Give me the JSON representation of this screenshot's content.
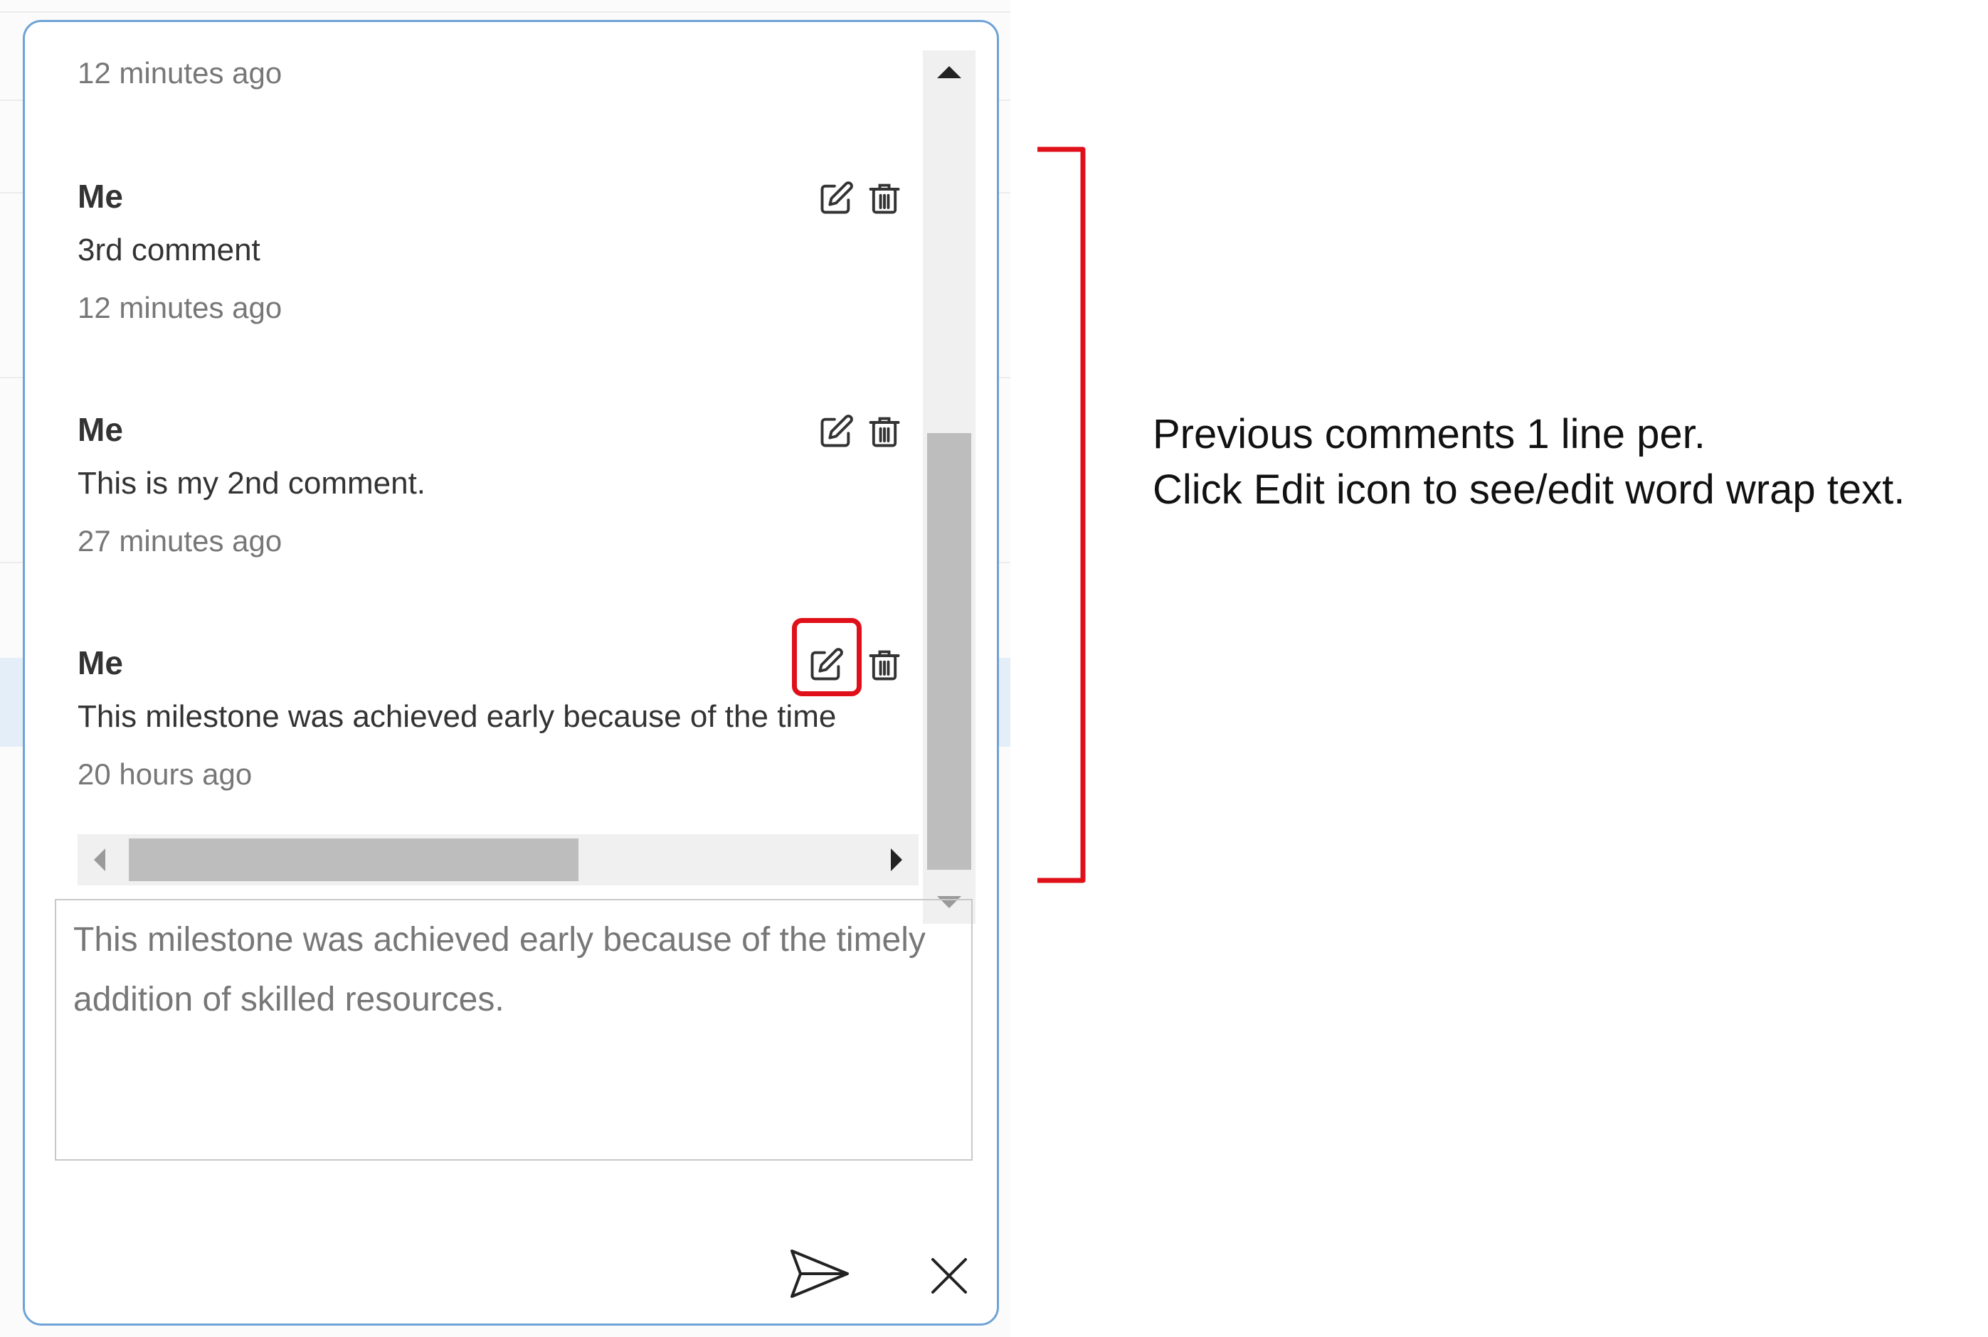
{
  "comments": [
    {
      "author": "",
      "text": "",
      "time": "12 minutes ago"
    },
    {
      "author": "Me",
      "text": "3rd comment",
      "time": "12 minutes ago"
    },
    {
      "author": "Me",
      "text": "This is my 2nd comment.",
      "time": "27 minutes ago"
    },
    {
      "author": "Me",
      "text": "This milestone was achieved early because of the time",
      "time": "20 hours ago"
    }
  ],
  "editor": {
    "value": "This milestone was achieved early because of the timely addition of skilled resources."
  },
  "annotation": {
    "line1": "Previous comments 1 line per.",
    "line2": "Click Edit icon to see/edit word wrap text."
  },
  "colors": {
    "popup_border": "#6fa3d6",
    "highlight": "#e0101a",
    "scroll_thumb": "#bdbdbd"
  },
  "icons": [
    "edit-icon",
    "trash-icon",
    "send-icon",
    "close-icon",
    "arrow-up-icon",
    "arrow-down-icon",
    "arrow-left-icon",
    "arrow-right-icon"
  ]
}
